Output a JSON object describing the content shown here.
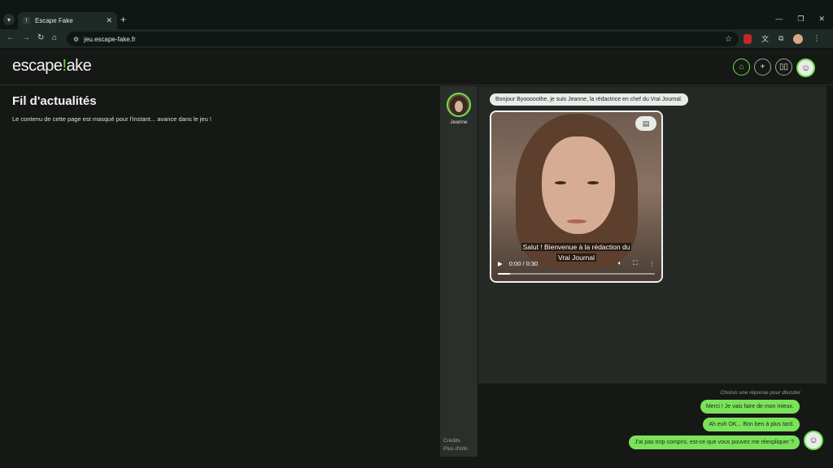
{
  "browser": {
    "tab_title": "Escape Fake",
    "tab_favicon": "!",
    "url": "jeu.escape-fake.fr"
  },
  "app": {
    "logo_part1": "escape",
    "logo_bang": "!",
    "logo_part2": "ake",
    "header_icons": [
      "home-icon",
      "plus-icon",
      "book-icon",
      "user-avatar"
    ]
  },
  "feed": {
    "title": "Fil d'actualités",
    "description": "Le contenu de cette page est masqué pour l'instant... avance dans le jeu !"
  },
  "contacts": [
    {
      "name": "Jeanne"
    }
  ],
  "side_links": {
    "credits": "Crédits",
    "more_info": "Plus d'info"
  },
  "chat": {
    "message": "Bonjour Byooooothe, je suis Jeanne, la rédactrice en chef du Vrai Journal.",
    "video": {
      "caption_line1": "Salut ! Bienvenue à la rédaction du",
      "caption_line2": "Vrai Journal",
      "time": "0:00 / 0:30",
      "progress": 0.08
    }
  },
  "answers": {
    "hint": "Choisis une réponse pour discuter",
    "options": [
      "Merci ! Je vais faire de mon mieux.",
      "Ah euh OK... Bon ben à plus tard.",
      "J'ai pas trop compris, est-ce que vous pouvez me réexpliquer ?"
    ]
  },
  "colors": {
    "accent": "#6fe04b",
    "answer_bg": "#7be35a",
    "background": "#151815"
  }
}
